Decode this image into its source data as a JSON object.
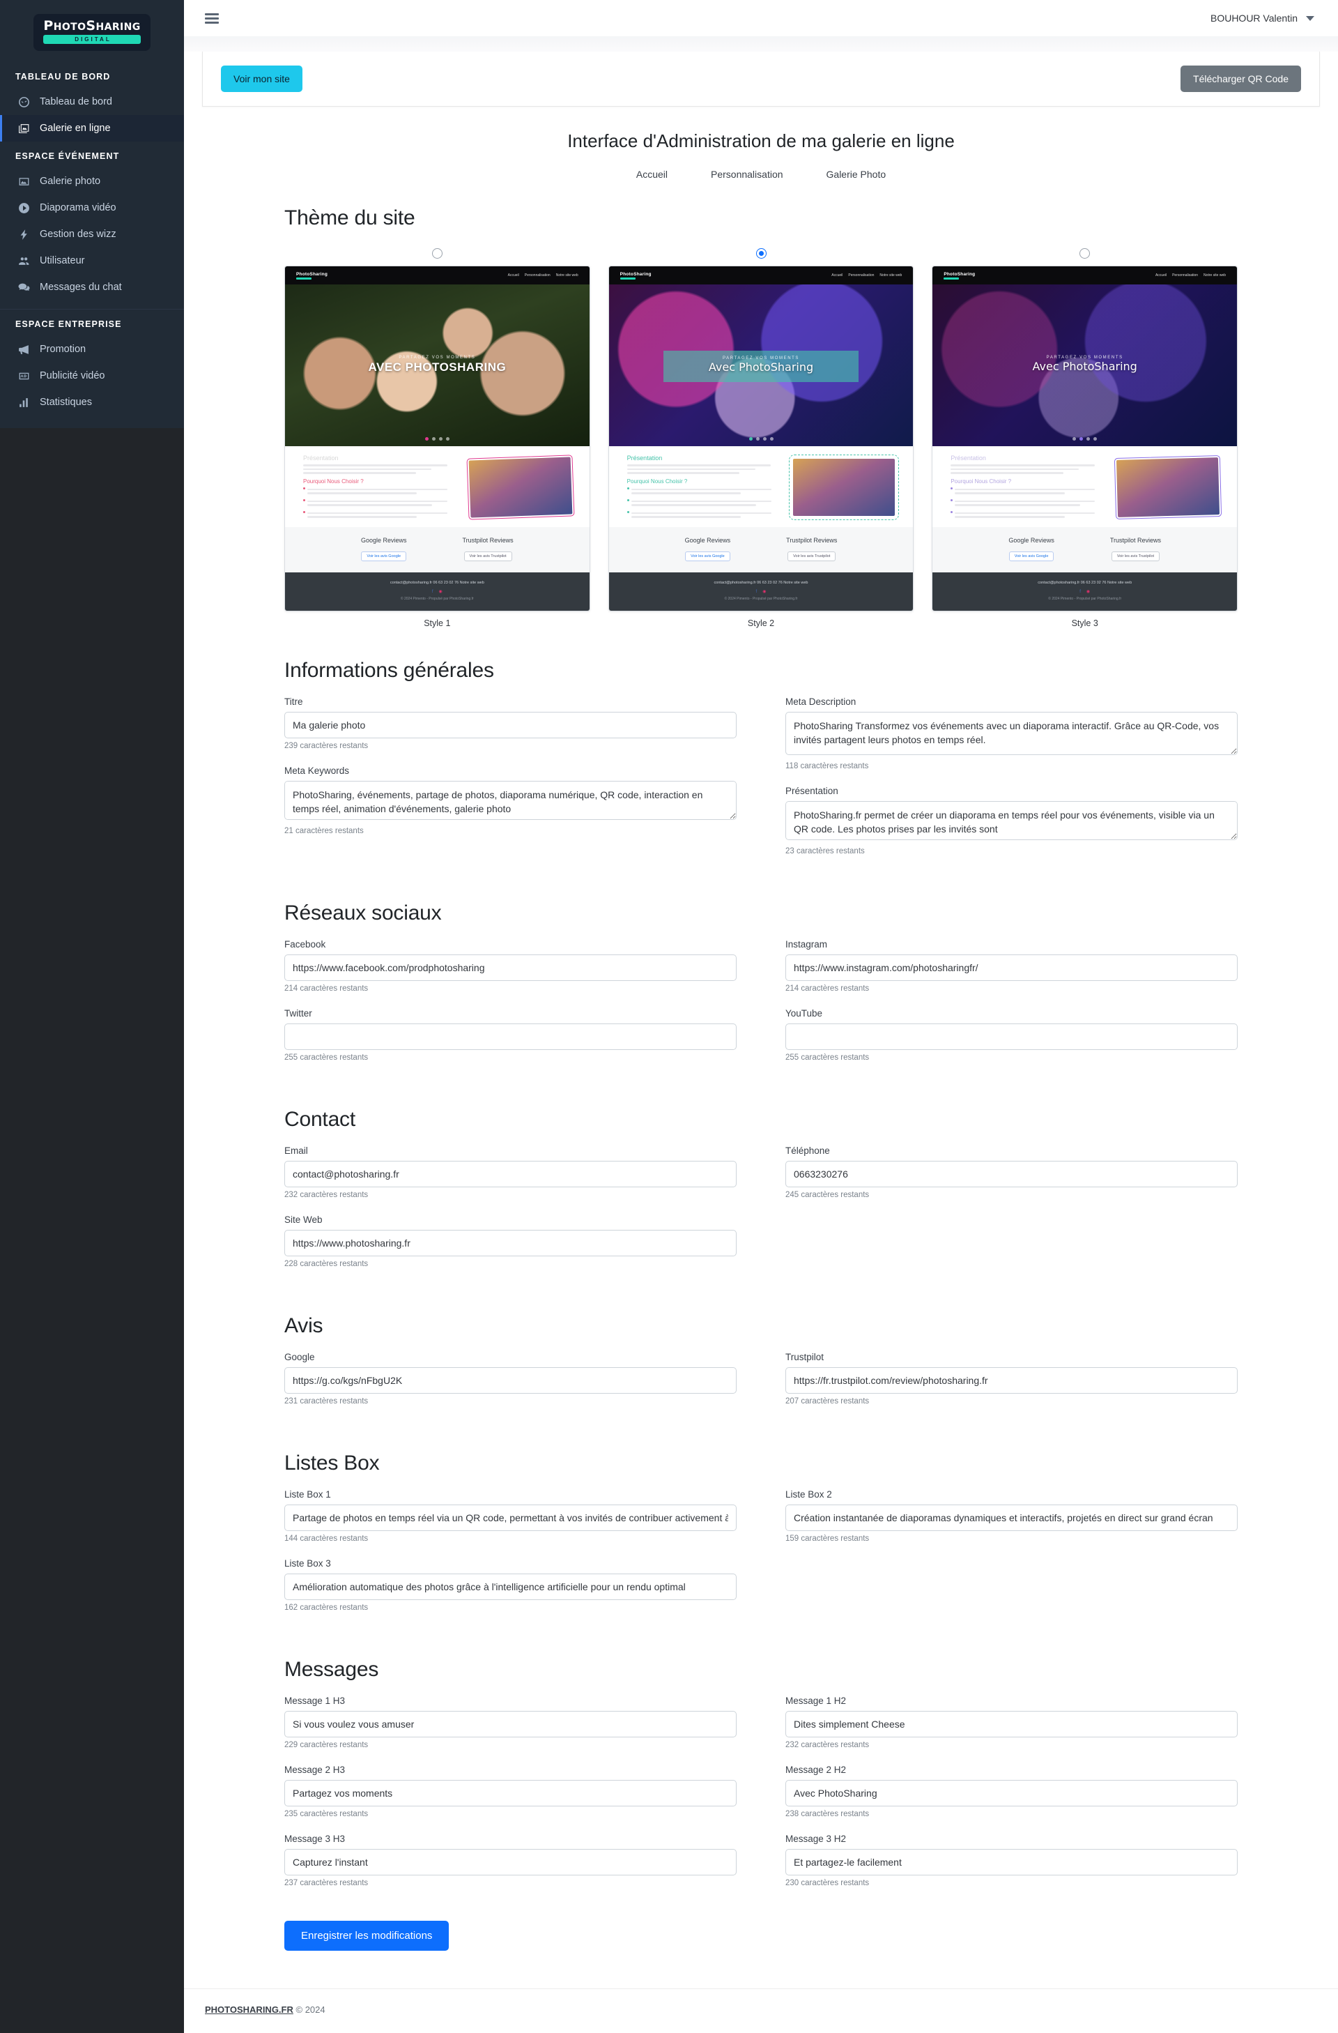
{
  "brand": {
    "name_part1": "P",
    "name_part2": "HOTO",
    "name_part3": "S",
    "name_part4": "HARING",
    "sub": "DIGITAL",
    "full": "PHOTOSHARING"
  },
  "sidebar": {
    "groups": [
      {
        "heading": "TABLEAU DE BORD",
        "items": [
          {
            "label": "Tableau de bord",
            "icon": "dashboard-icon",
            "active": false
          },
          {
            "label": "Galerie en ligne",
            "icon": "images-icon",
            "active": true
          }
        ]
      },
      {
        "heading": "ESPACE ÉVÉNEMENT",
        "items": [
          {
            "label": "Galerie photo",
            "icon": "photo-icon",
            "active": false
          },
          {
            "label": "Diaporama vidéo",
            "icon": "play-circle-icon",
            "active": false
          },
          {
            "label": "Gestion des wizz",
            "icon": "bolt-icon",
            "active": false
          },
          {
            "label": "Utilisateur",
            "icon": "users-icon",
            "active": false
          },
          {
            "label": "Messages du chat",
            "icon": "chat-icon",
            "active": false
          }
        ]
      },
      {
        "heading": "ESPACE ENTREPRISE",
        "items": [
          {
            "label": "Promotion",
            "icon": "megaphone-icon",
            "active": false
          },
          {
            "label": "Publicité vidéo",
            "icon": "ad-icon",
            "active": false
          },
          {
            "label": "Statistiques",
            "icon": "bar-chart-icon",
            "active": false
          }
        ]
      }
    ]
  },
  "topbar": {
    "user_name": "BOUHOUR Valentin"
  },
  "actionbar": {
    "view_site_label": "Voir mon site",
    "qr_label": "Télécharger QR Code"
  },
  "page": {
    "title": "Interface d'Administration de ma galerie en ligne",
    "subnav": [
      "Accueil",
      "Personnalisation",
      "Galerie Photo"
    ]
  },
  "theme": {
    "heading": "Thème du site",
    "selected_index": 1,
    "styles": [
      {
        "label": "Style 1",
        "hero_sub": "PARTAGEZ VOS MOMENTS",
        "hero_title": "AVEC PHOTOSHARING",
        "presentation_title": "Présentation",
        "why_title": "Pourquoi Nous Choisir ?",
        "nav_links": [
          "Accueil",
          "Personnalisation",
          "Notre site web"
        ],
        "reviews": [
          {
            "title": "Google Reviews",
            "button": "Voir les avis Google"
          },
          {
            "title": "Trustpilot Reviews",
            "button": "Voir les avis Trustpilot"
          }
        ],
        "footer_contact": "contact@photosharing.fr  06 63 23 02 76  Notre site web",
        "footer_copy": "© 2024 Pimento - Propulsé par PhotoSharing.fr"
      },
      {
        "label": "Style 2",
        "hero_sub": "PARTAGEZ VOS MOMENTS",
        "hero_title": "Avec PhotoSharing",
        "presentation_title": "Présentation",
        "why_title": "Pourquoi Nous Choisir ?",
        "nav_links": [
          "Accueil",
          "Personnalisation",
          "Notre site web"
        ],
        "reviews": [
          {
            "title": "Google Reviews",
            "button": "Voir les avis Google"
          },
          {
            "title": "Trustpilot Reviews",
            "button": "Voir les avis Trustpilot"
          }
        ],
        "footer_contact": "contact@photosharing.fr  06 63 23 02 76  Notre site web",
        "footer_copy": "© 2024 Pimento - Propulsé par PhotoSharing.fr"
      },
      {
        "label": "Style 3",
        "hero_sub": "PARTAGEZ VOS MOMENTS",
        "hero_title": "Avec PhotoSharing",
        "presentation_title": "Présentation",
        "why_title": "Pourquoi Nous Choisir ?",
        "nav_links": [
          "Accueil",
          "Personnalisation",
          "Notre site web"
        ],
        "reviews": [
          {
            "title": "Google Reviews",
            "button": "Voir les avis Google"
          },
          {
            "title": "Trustpilot Reviews",
            "button": "Voir les avis Trustpilot"
          }
        ],
        "footer_contact": "contact@photosharing.fr  06 63 23 02 76  Notre site web",
        "footer_copy": "© 2024 Pimento - Propulsé par PhotoSharing.fr"
      }
    ]
  },
  "general": {
    "heading": "Informations générales",
    "titre": {
      "label": "Titre",
      "value": "Ma galerie photo",
      "counter": "239 caractères restants"
    },
    "meta_description": {
      "label": "Meta Description",
      "value": "PhotoSharing Transformez vos événements avec un diaporama interactif. Grâce au QR-Code, vos invités partagent leurs photos en temps réel.",
      "counter": "118 caractères restants"
    },
    "meta_keywords": {
      "label": "Meta Keywords",
      "value": "PhotoSharing, événements, partage de photos, diaporama numérique, QR code, interaction en temps réel, animation d'événements, galerie photo",
      "counter": "21 caractères restants"
    },
    "presentation": {
      "label": "Présentation",
      "value": "PhotoSharing.fr permet de créer un diaporama en temps réel pour vos événements, visible via un QR code. Les photos prises par les invités sont",
      "counter": "23 caractères restants"
    }
  },
  "social": {
    "heading": "Réseaux sociaux",
    "facebook": {
      "label": "Facebook",
      "value": "https://www.facebook.com/prodphotosharing",
      "counter": "214 caractères restants"
    },
    "instagram": {
      "label": "Instagram",
      "value": "https://www.instagram.com/photosharingfr/",
      "counter": "214 caractères restants"
    },
    "twitter": {
      "label": "Twitter",
      "value": "",
      "counter": "255 caractères restants"
    },
    "youtube": {
      "label": "YouTube",
      "value": "",
      "counter": "255 caractères restants"
    }
  },
  "contact": {
    "heading": "Contact",
    "email": {
      "label": "Email",
      "value": "contact@photosharing.fr",
      "counter": "232 caractères restants"
    },
    "telephone": {
      "label": "Téléphone",
      "value": "0663230276",
      "counter": "245 caractères restants"
    },
    "site_web": {
      "label": "Site Web",
      "value": "https://www.photosharing.fr",
      "counter": "228 caractères restants"
    }
  },
  "avis": {
    "heading": "Avis",
    "google": {
      "label": "Google",
      "value": "https://g.co/kgs/nFbgU2K",
      "counter": "231 caractères restants"
    },
    "trustpilot": {
      "label": "Trustpilot",
      "value": "https://fr.trustpilot.com/review/photosharing.fr",
      "counter": "207 caractères restants"
    }
  },
  "listes_box": {
    "heading": "Listes Box",
    "box1": {
      "label": "Liste Box 1",
      "value": "Partage de photos en temps réel via un QR code, permettant à vos invités de contribuer activement à l'événement",
      "counter": "144 caractères restants"
    },
    "box2": {
      "label": "Liste Box 2",
      "value": "Création instantanée de diaporamas dynamiques et interactifs, projetés en direct sur grand écran",
      "counter": "159 caractères restants"
    },
    "box3": {
      "label": "Liste Box 3",
      "value": "Amélioration automatique des photos grâce à l'intelligence artificielle pour un rendu optimal",
      "counter": "162 caractères restants"
    }
  },
  "messages": {
    "heading": "Messages",
    "m1h3": {
      "label": "Message 1 H3",
      "value": "Si vous voulez vous amuser",
      "counter": "229 caractères restants"
    },
    "m1h2": {
      "label": "Message 1 H2",
      "value": "Dites simplement Cheese",
      "counter": "232 caractères restants"
    },
    "m2h3": {
      "label": "Message 2 H3",
      "value": "Partagez vos moments",
      "counter": "235 caractères restants"
    },
    "m2h2": {
      "label": "Message 2 H2",
      "value": "Avec PhotoSharing",
      "counter": "238 caractères restants"
    },
    "m3h3": {
      "label": "Message 3 H3",
      "value": "Capturez l'instant",
      "counter": "237 caractères restants"
    },
    "m3h2": {
      "label": "Message 3 H2",
      "value": "Et partagez-le facilement",
      "counter": "230 caractères restants"
    }
  },
  "save": {
    "label": "Enregistrer les modifications"
  },
  "footer": {
    "brand": "PHOTOSHARING.FR",
    "copyright": "© 2024"
  },
  "colors": {
    "sidebar_bg": "#212b36",
    "sidebar_active": "#1c2635",
    "accent_blue": "#0d6efd",
    "accent_cyan": "#1ec8ec",
    "gray_button": "#6c757d",
    "brand_teal": "#1fd8b5"
  }
}
